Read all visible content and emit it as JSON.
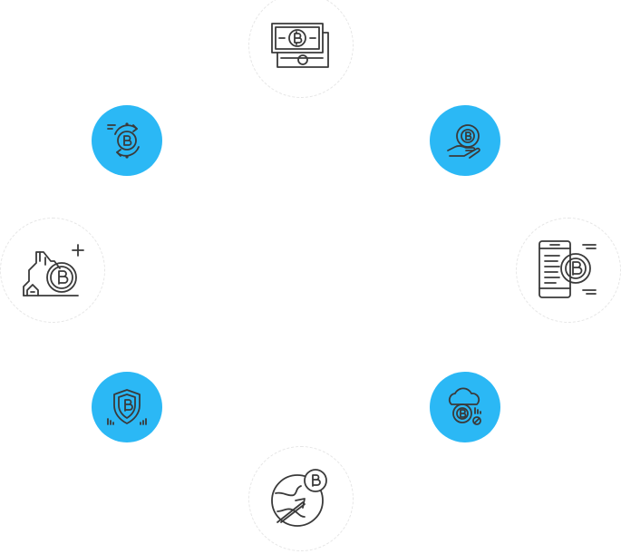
{
  "nodes": [
    {
      "id": "top",
      "icon": "banknote-bitcoin-icon",
      "style": "outlined"
    },
    {
      "id": "upper-left",
      "icon": "bitcoin-exchange-cycle-icon",
      "style": "blue"
    },
    {
      "id": "upper-right",
      "icon": "hand-holding-bitcoin-icon",
      "style": "blue"
    },
    {
      "id": "left",
      "icon": "bitcoin-mining-icon",
      "style": "outlined"
    },
    {
      "id": "right",
      "icon": "mobile-bitcoin-wallet-icon",
      "style": "outlined"
    },
    {
      "id": "lower-left",
      "icon": "bitcoin-shield-icon",
      "style": "blue"
    },
    {
      "id": "lower-right",
      "icon": "cloud-bitcoin-icon",
      "style": "blue"
    },
    {
      "id": "bottom",
      "icon": "global-bitcoin-growth-icon",
      "style": "outlined"
    }
  ],
  "colors": {
    "accent": "#2bb8f5",
    "ink": "#3a3a3a",
    "ring_border": "#e6e6e6",
    "background": "#ffffff"
  }
}
